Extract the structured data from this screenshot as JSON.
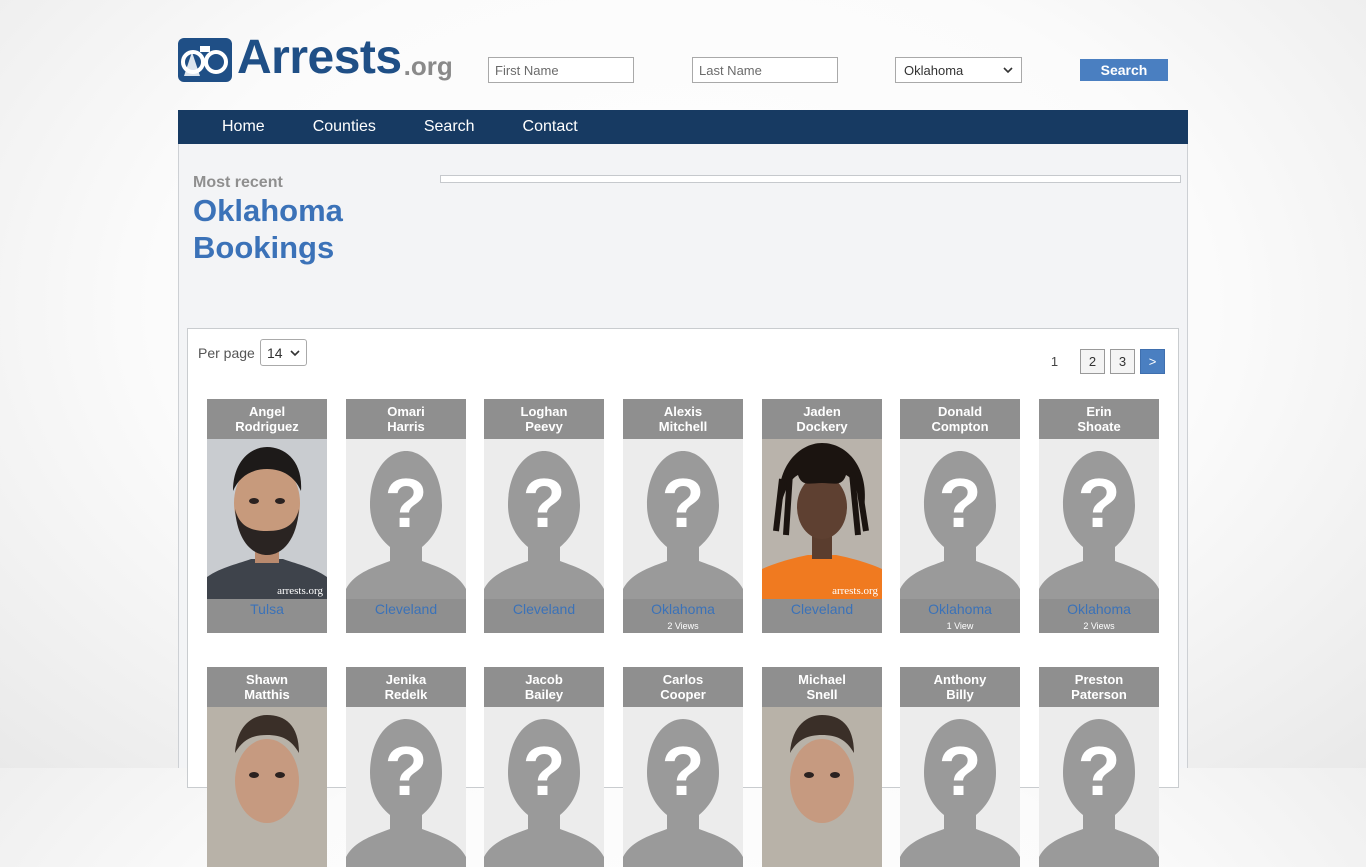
{
  "header": {
    "logo_text": "Arrests",
    "logo_suffix": ".org",
    "first_name_placeholder": "First Name",
    "last_name_placeholder": "Last Name",
    "state_selected": "Oklahoma",
    "search_label": "Search"
  },
  "nav": [
    "Home",
    "Counties",
    "Search",
    "Contact"
  ],
  "intro": {
    "most_recent": "Most recent",
    "title": "Oklahoma Bookings"
  },
  "controls": {
    "per_page_label": "Per page",
    "per_page_value": "14",
    "pages": [
      "1",
      "2",
      "3"
    ],
    "next": ">"
  },
  "bookings": [
    {
      "first": "Angel",
      "last": "Rodriguez",
      "county": "Tulsa",
      "views": "",
      "photo": "mugshot-man-beard"
    },
    {
      "first": "Omari",
      "last": "Harris",
      "county": "Cleveland",
      "views": "",
      "photo": "placeholder"
    },
    {
      "first": "Loghan",
      "last": "Peevy",
      "county": "Cleveland",
      "views": "",
      "photo": "placeholder"
    },
    {
      "first": "Alexis",
      "last": "Mitchell",
      "county": "Oklahoma",
      "views": "2 Views",
      "photo": "placeholder"
    },
    {
      "first": "Jaden",
      "last": "Dockery",
      "county": "Cleveland",
      "views": "",
      "photo": "mugshot-dreadlocks-orange"
    },
    {
      "first": "Donald",
      "last": "Compton",
      "county": "Oklahoma",
      "views": "1 View",
      "photo": "placeholder"
    },
    {
      "first": "Erin",
      "last": "Shoate",
      "county": "Oklahoma",
      "views": "2 Views",
      "photo": "placeholder"
    },
    {
      "first": "Shawn",
      "last": "Matthis",
      "county": "",
      "views": "",
      "photo": "mugshot-man"
    },
    {
      "first": "Jenika",
      "last": "Redelk",
      "county": "",
      "views": "",
      "photo": "placeholder"
    },
    {
      "first": "Jacob",
      "last": "Bailey",
      "county": "",
      "views": "",
      "photo": "placeholder"
    },
    {
      "first": "Carlos",
      "last": "Cooper",
      "county": "",
      "views": "",
      "photo": "placeholder"
    },
    {
      "first": "Michael",
      "last": "Snell",
      "county": "",
      "views": "",
      "photo": "mugshot-man"
    },
    {
      "first": "Anthony",
      "last": "Billy",
      "county": "",
      "views": "",
      "photo": "placeholder"
    },
    {
      "first": "Preston",
      "last": "Paterson",
      "county": "",
      "views": "",
      "photo": "placeholder"
    }
  ],
  "watermark": "arrests.org",
  "colors": {
    "brand": "#1f4f86",
    "nav": "#173a62",
    "link": "#3b72b8",
    "button": "#4a7fc1",
    "card": "#8f8f8f"
  }
}
